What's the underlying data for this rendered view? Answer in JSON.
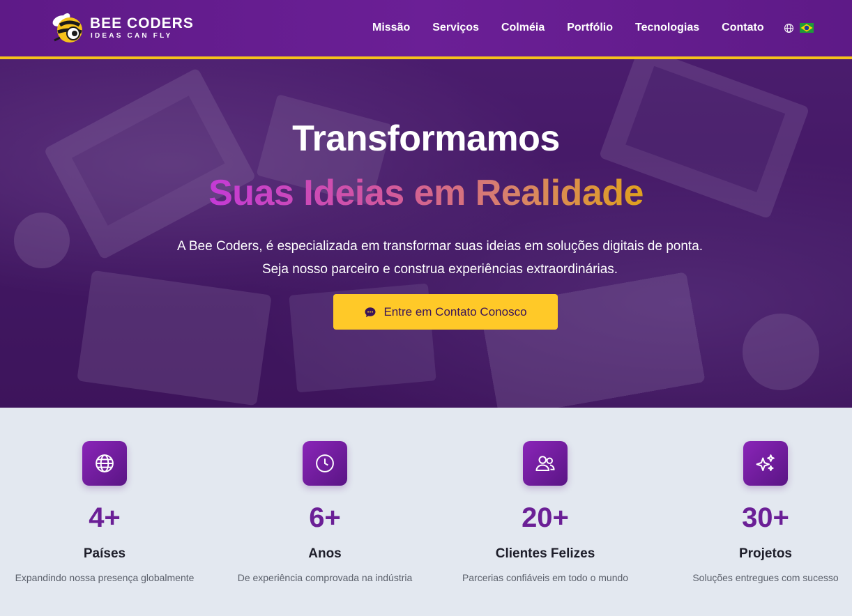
{
  "header": {
    "logo_title": "BEE CODERS",
    "logo_tagline": "IDEAS CAN FLY",
    "nav": [
      {
        "label": "Missão"
      },
      {
        "label": "Serviços"
      },
      {
        "label": "Colméia"
      },
      {
        "label": "Portfólio"
      },
      {
        "label": "Tecnologias"
      },
      {
        "label": "Contato"
      }
    ],
    "language_icon": "globe-icon",
    "language_flag": "brazil-flag"
  },
  "hero": {
    "title_line1": "Transformamos",
    "title_line2": "Suas Ideias em Realidade",
    "description_prefix": "A ",
    "description_brand": "Bee Coders",
    "description_rest": ", é especializada em transformar suas ideias em soluções digitais de ponta. Seja nosso parceiro e construa experiências extraordinárias.",
    "cta_label": "Entre em Contato Conosco",
    "cta_icon": "chat-bubble-icon"
  },
  "stats": [
    {
      "icon": "globe-icon",
      "value": "4+",
      "label": "Países",
      "description": "Expandindo nossa presença globalmente"
    },
    {
      "icon": "clock-icon",
      "value": "6+",
      "label": "Anos",
      "description": "De experiência comprovada na indústria"
    },
    {
      "icon": "users-icon",
      "value": "20+",
      "label": "Clientes Felizes",
      "description": "Parcerias confiáveis em todo o mundo"
    },
    {
      "icon": "sparkles-icon",
      "value": "30+",
      "label": "Projetos",
      "description": "Soluções entregues com sucesso"
    }
  ],
  "colors": {
    "primary": "#6b1f96",
    "accent": "#ffc928",
    "header_border": "#f6c21b",
    "stats_bg": "#e3e8f0"
  }
}
